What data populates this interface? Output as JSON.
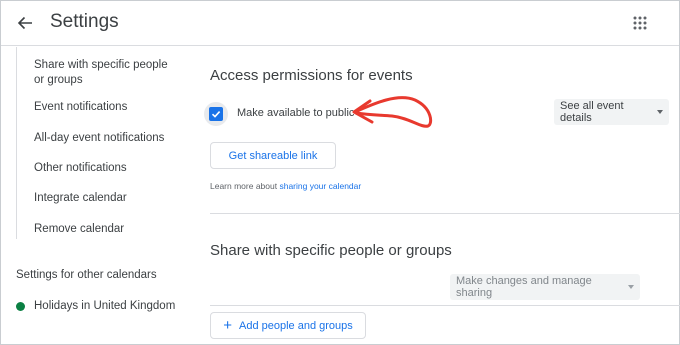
{
  "header": {
    "title": "Settings",
    "back_icon": "arrow-back-icon",
    "apps_icon": "apps-grid-icon"
  },
  "sidebar": {
    "items": [
      {
        "label": "Share with specific people"
      },
      {
        "label": "or groups"
      },
      {
        "label": "Event notifications"
      },
      {
        "label": "All-day event notifications"
      },
      {
        "label": "Other notifications"
      },
      {
        "label": "Integrate calendar"
      },
      {
        "label": "Remove calendar"
      }
    ],
    "other_heading": "Settings for other calendars",
    "other_calendars": [
      {
        "label": "Holidays in United Kingdom",
        "color": "#0b8043"
      }
    ]
  },
  "access": {
    "title": "Access permissions for events",
    "public_checkbox_label": "Make available to public",
    "public_checked": true,
    "detail_select": "See all event details",
    "shareable_link_button": "Get shareable link",
    "learn_prefix": "Learn more about ",
    "learn_link": "sharing your calendar"
  },
  "share": {
    "title": "Share with specific people or groups",
    "permission_select": "Make changes and manage sharing",
    "add_button": "Add people and groups"
  },
  "colors": {
    "accent": "#1a73e8",
    "annotation_arrow": "#e8392e"
  }
}
